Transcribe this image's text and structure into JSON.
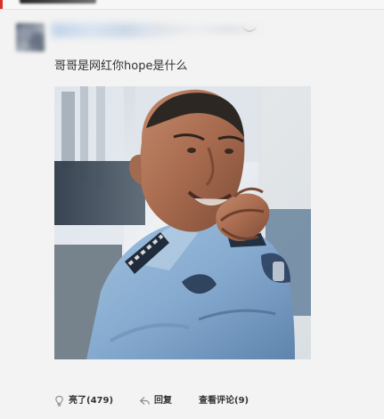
{
  "post": {
    "text": "哥哥是网红你hope是什么"
  },
  "actions": {
    "like_label": "亮了(479)",
    "reply_label": "回复",
    "comments_label": "查看评论(9)"
  },
  "icons": {
    "like": "lightbulb-icon",
    "reply": "reply-arrow-icon"
  },
  "colors": {
    "page_bg": "#f3f3f3",
    "text": "#333333",
    "accent": "#d9302c"
  }
}
